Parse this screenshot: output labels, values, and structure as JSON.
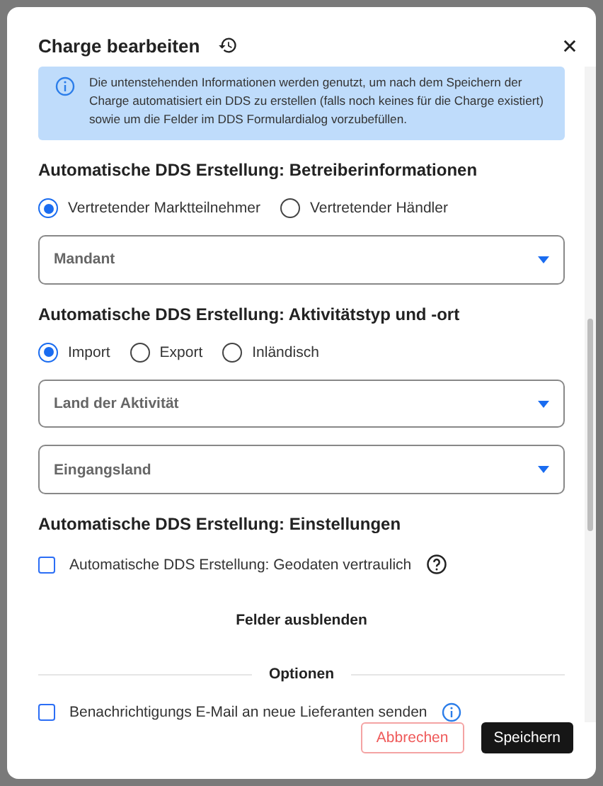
{
  "dialog": {
    "title": "Charge bearbeiten"
  },
  "info": "Die untenstehenden Informationen werden genutzt, um nach dem Speichern der Charge automatisiert ein DDS zu erstellen (falls noch keines für die Charge existiert) sowie um die Felder im DDS Formulardialog vorzubefüllen.",
  "sections": [
    {
      "kind": "group",
      "heading": "Automatische DDS Erstellung: Betreiberinformationen",
      "radios": [
        {
          "label": "Vertretender Marktteilnehmer",
          "selected": true
        },
        {
          "label": "Vertretender Händler",
          "selected": false
        }
      ],
      "selects": [
        {
          "placeholder": "Mandant"
        }
      ]
    },
    {
      "kind": "group",
      "heading": "Automatische DDS Erstellung: Aktivitätstyp und -ort",
      "radios": [
        {
          "label": "Import",
          "selected": true
        },
        {
          "label": "Export",
          "selected": false
        },
        {
          "label": "Inländisch",
          "selected": false
        }
      ],
      "selects": [
        {
          "placeholder": "Land der Aktivität"
        },
        {
          "placeholder": "Eingangsland"
        }
      ]
    },
    {
      "kind": "settings",
      "heading": "Automatische DDS Erstellung: Einstellungen",
      "checkbox": {
        "label": "Automatische DDS Erstellung: Geodaten vertraulich",
        "checked": false
      }
    }
  ],
  "toggle_link": "Felder ausblenden",
  "options": {
    "title": "Optionen",
    "checkbox": {
      "label": "Benachrichtigungs E-Mail an neue Lieferanten senden",
      "checked": false
    }
  },
  "buttons": {
    "cancel": "Abbrechen",
    "save": "Speichern"
  }
}
